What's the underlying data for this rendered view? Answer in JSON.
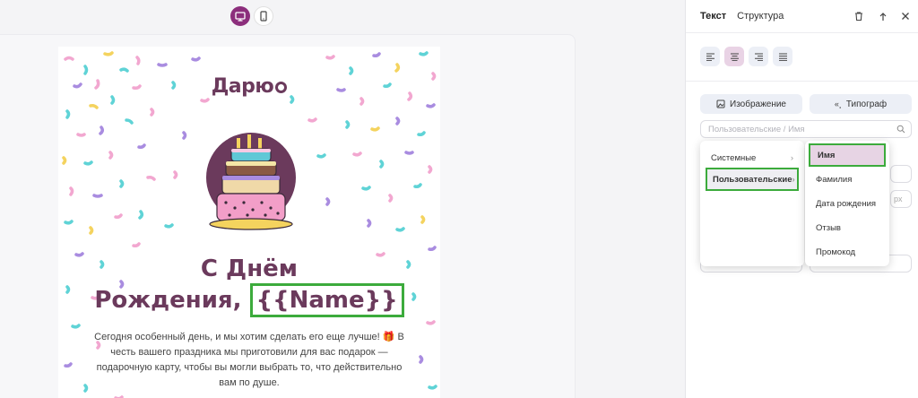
{
  "toolbar": {
    "desktop_icon": "monitor-icon",
    "mobile_icon": "phone-icon"
  },
  "email": {
    "logo": "Дарю",
    "headline_line1": "С Днём",
    "headline_line2": "Рождения,",
    "name_var": "{{Name}}",
    "body_text": "Сегодня особенный день, и мы хотим сделать его еще лучше! 🎁 В честь вашего праздника мы приготовили для вас подарок — подарочную карту, чтобы вы могли выбрать то, что действительно вам по душе."
  },
  "panel": {
    "tabs": [
      "Текст",
      "Структура"
    ],
    "active_tab": "Текст",
    "actions": [
      "trash-icon",
      "undo-icon",
      "close-icon"
    ],
    "align_buttons": [
      "align-left-icon",
      "align-center-icon",
      "align-right-icon",
      "align-justify-icon"
    ],
    "active_align": "align-center",
    "insert_image_label": "Изображение",
    "insert_typograph_label": "Типограф",
    "search_placeholder": "Пользовательские / Имя"
  },
  "menu": {
    "items": [
      {
        "label": "Системные"
      },
      {
        "label": "Пользовательские",
        "highlighted": true
      }
    ],
    "chevron": "chevron-right-icon"
  },
  "submenu": {
    "items": [
      {
        "label": "Имя",
        "highlighted": true
      },
      {
        "label": "Фамилия"
      },
      {
        "label": "Дата рождения"
      },
      {
        "label": "Отзыв"
      },
      {
        "label": "Промокод"
      }
    ]
  },
  "colors": {
    "brand": "#6b3a5c",
    "accent": "#8c2e7c",
    "highlight_box": "#3cab3c",
    "selected_item": "#e7d4e4"
  },
  "hidden_fields": {
    "unit_label": "px"
  }
}
